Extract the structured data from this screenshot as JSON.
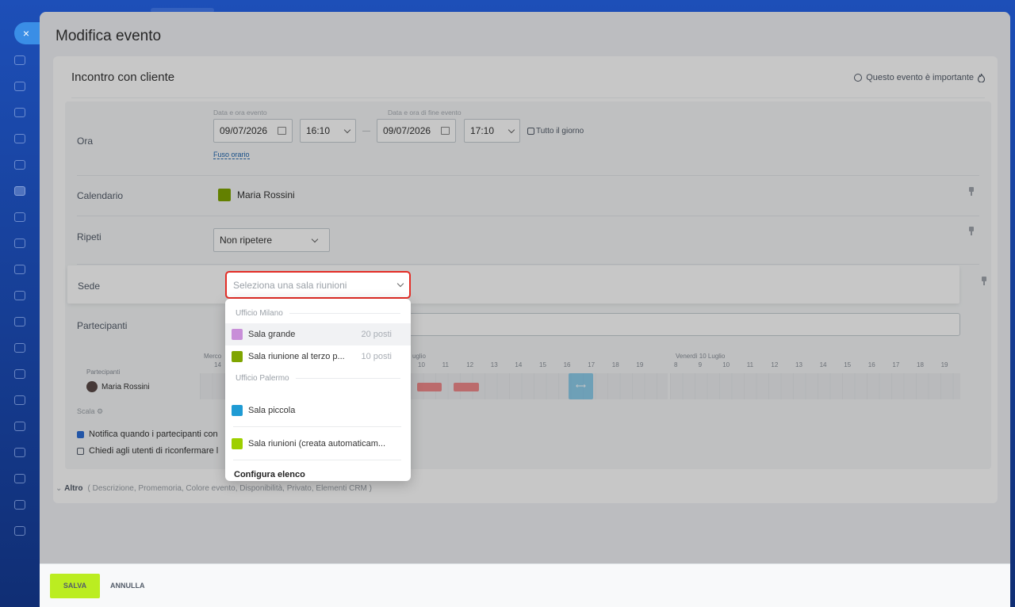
{
  "slider": {
    "title": "Modifica evento",
    "close_icon": "×"
  },
  "event": {
    "name": "Incontro con cliente",
    "important_label": "Questo evento è importante"
  },
  "time": {
    "label": "Ora",
    "start_label": "Data e ora evento",
    "end_label": "Data e ora di fine evento",
    "start_date": "09/07/2026",
    "start_time": "16:10",
    "end_date": "09/07/2026",
    "end_time": "17:10",
    "dash": "—",
    "all_day": "Tutto il giorno",
    "timezone": "Fuso orario"
  },
  "calendar": {
    "label": "Calendario",
    "owner": "Maria Rossini",
    "color": "#7fa500"
  },
  "repeat": {
    "label": "Ripeti",
    "value": "Non ripetere"
  },
  "location": {
    "label": "Sede",
    "placeholder": "Seleziona una sala riunioni",
    "menu": {
      "groups": [
        {
          "name": "Ufficio Milano",
          "rooms": [
            {
              "name": "Sala grande",
              "seats": "20 posti",
              "color": "#c88ed8"
            },
            {
              "name": "Sala riunione al terzo p...",
              "seats": "10 posti",
              "color": "#7fa500"
            }
          ]
        },
        {
          "name": "Ufficio Palermo",
          "rooms": [
            {
              "name": "Sala piccola",
              "seats": "",
              "color": "#1f9bd4"
            }
          ]
        }
      ],
      "auto_room": {
        "name": "Sala riunioni (creata automaticam...",
        "color": "#9dcf00"
      },
      "configure": "Configura elenco"
    }
  },
  "participants": {
    "label": "Partecipanti",
    "planner_label": "Partecipanti",
    "person": "Maria Rossini",
    "scale": "Scala",
    "day_left": "Merco",
    "day_left_hour": "14",
    "day_mid": "uglio",
    "day_right": "Venerdì 10 Luglio",
    "hours_mid": [
      "10",
      "11",
      "12",
      "13",
      "14",
      "15",
      "16",
      "17",
      "18",
      "19"
    ],
    "hours_right": [
      "8",
      "9",
      "10",
      "11",
      "12",
      "13",
      "14",
      "15",
      "16",
      "17",
      "18",
      "19"
    ],
    "notify": "Notifica quando i partecipanti con",
    "reconfirm": "Chiedi agli utenti di riconfermare l"
  },
  "more": {
    "label": "Altro",
    "items": "( Descrizione,  Promemoria,  Colore evento,  Disponibilità,  Privato,  Elementi CRM )"
  },
  "footer": {
    "save": "SALVA",
    "cancel": "ANNULLA"
  },
  "colors": {
    "accent": "#bbed21",
    "highlight": "#e42d26",
    "brand_blue": "#3a8ee6"
  }
}
